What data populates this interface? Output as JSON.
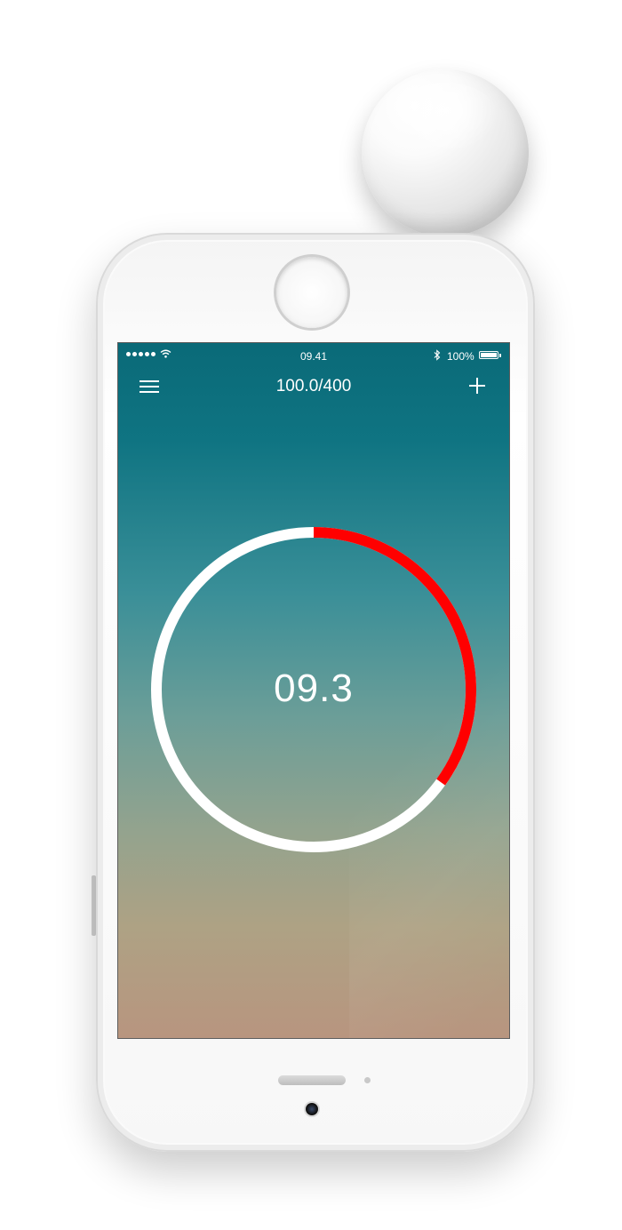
{
  "status_bar": {
    "signal_dots": 5,
    "time": "09.41",
    "battery": "100%"
  },
  "nav": {
    "title": "100.0/400",
    "menu_icon": "hamburger-menu-icon",
    "add_icon": "plus-icon"
  },
  "gauge": {
    "reading": "09.3",
    "progress_fraction": 0.35,
    "track_color": "#ffffff",
    "progress_color": "#ff0000"
  },
  "colors": {
    "screen_top": "#0a6a78",
    "screen_bottom": "#b8957f"
  }
}
